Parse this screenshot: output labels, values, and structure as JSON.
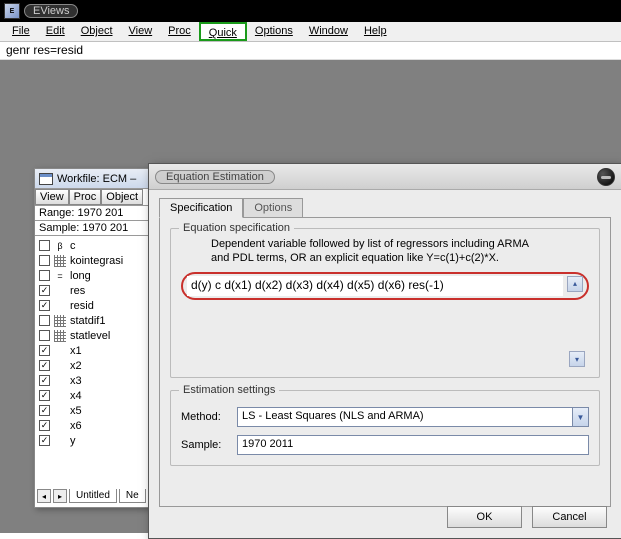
{
  "app": {
    "title": "EViews"
  },
  "menu": {
    "file": "File",
    "edit": "Edit",
    "object": "Object",
    "view": "View",
    "proc": "Proc",
    "quick": "Quick",
    "options": "Options",
    "window": "Window",
    "help": "Help"
  },
  "command_line": "genr res=resid",
  "workfile": {
    "title": "Workfile: ECM –",
    "buttons": {
      "view": "View",
      "proc": "Proc",
      "object": "Object"
    },
    "range": "Range:  1970 201",
    "sample": "Sample: 1970 201",
    "items": [
      {
        "label": "c",
        "checked": false,
        "icon": "c"
      },
      {
        "label": "kointegrasi",
        "checked": false,
        "icon": "grid"
      },
      {
        "label": "long",
        "checked": false,
        "icon": "eq"
      },
      {
        "label": "res",
        "checked": true,
        "icon": "series"
      },
      {
        "label": "resid",
        "checked": true,
        "icon": "series"
      },
      {
        "label": "statdif1",
        "checked": false,
        "icon": "grid"
      },
      {
        "label": "statlevel",
        "checked": false,
        "icon": "grid"
      },
      {
        "label": "x1",
        "checked": true,
        "icon": "series"
      },
      {
        "label": "x2",
        "checked": true,
        "icon": "series"
      },
      {
        "label": "x3",
        "checked": true,
        "icon": "series"
      },
      {
        "label": "x4",
        "checked": true,
        "icon": "series"
      },
      {
        "label": "x5",
        "checked": true,
        "icon": "series"
      },
      {
        "label": "x6",
        "checked": true,
        "icon": "series"
      },
      {
        "label": "y",
        "checked": true,
        "icon": "series"
      }
    ],
    "tabs": {
      "untitled": "Untitled",
      "new": "Ne"
    }
  },
  "dialog": {
    "title": "Equation Estimation",
    "tabs": {
      "specification": "Specification",
      "options": "Options"
    },
    "specification": {
      "group_label": "Equation specification",
      "description1": "Dependent variable followed by list of regressors including ARMA",
      "description2": "and PDL terms, OR an explicit equation like Y=c(1)+c(2)*X.",
      "equation": "d(y) c d(x1) d(x2) d(x3) d(x4) d(x5) d(x6) res(-1)"
    },
    "settings": {
      "group_label": "Estimation settings",
      "method_label": "Method:",
      "method_value": "LS  -  Least Squares (NLS and ARMA)",
      "sample_label": "Sample:",
      "sample_value": "1970 2011"
    },
    "buttons": {
      "ok": "OK",
      "cancel": "Cancel"
    }
  }
}
